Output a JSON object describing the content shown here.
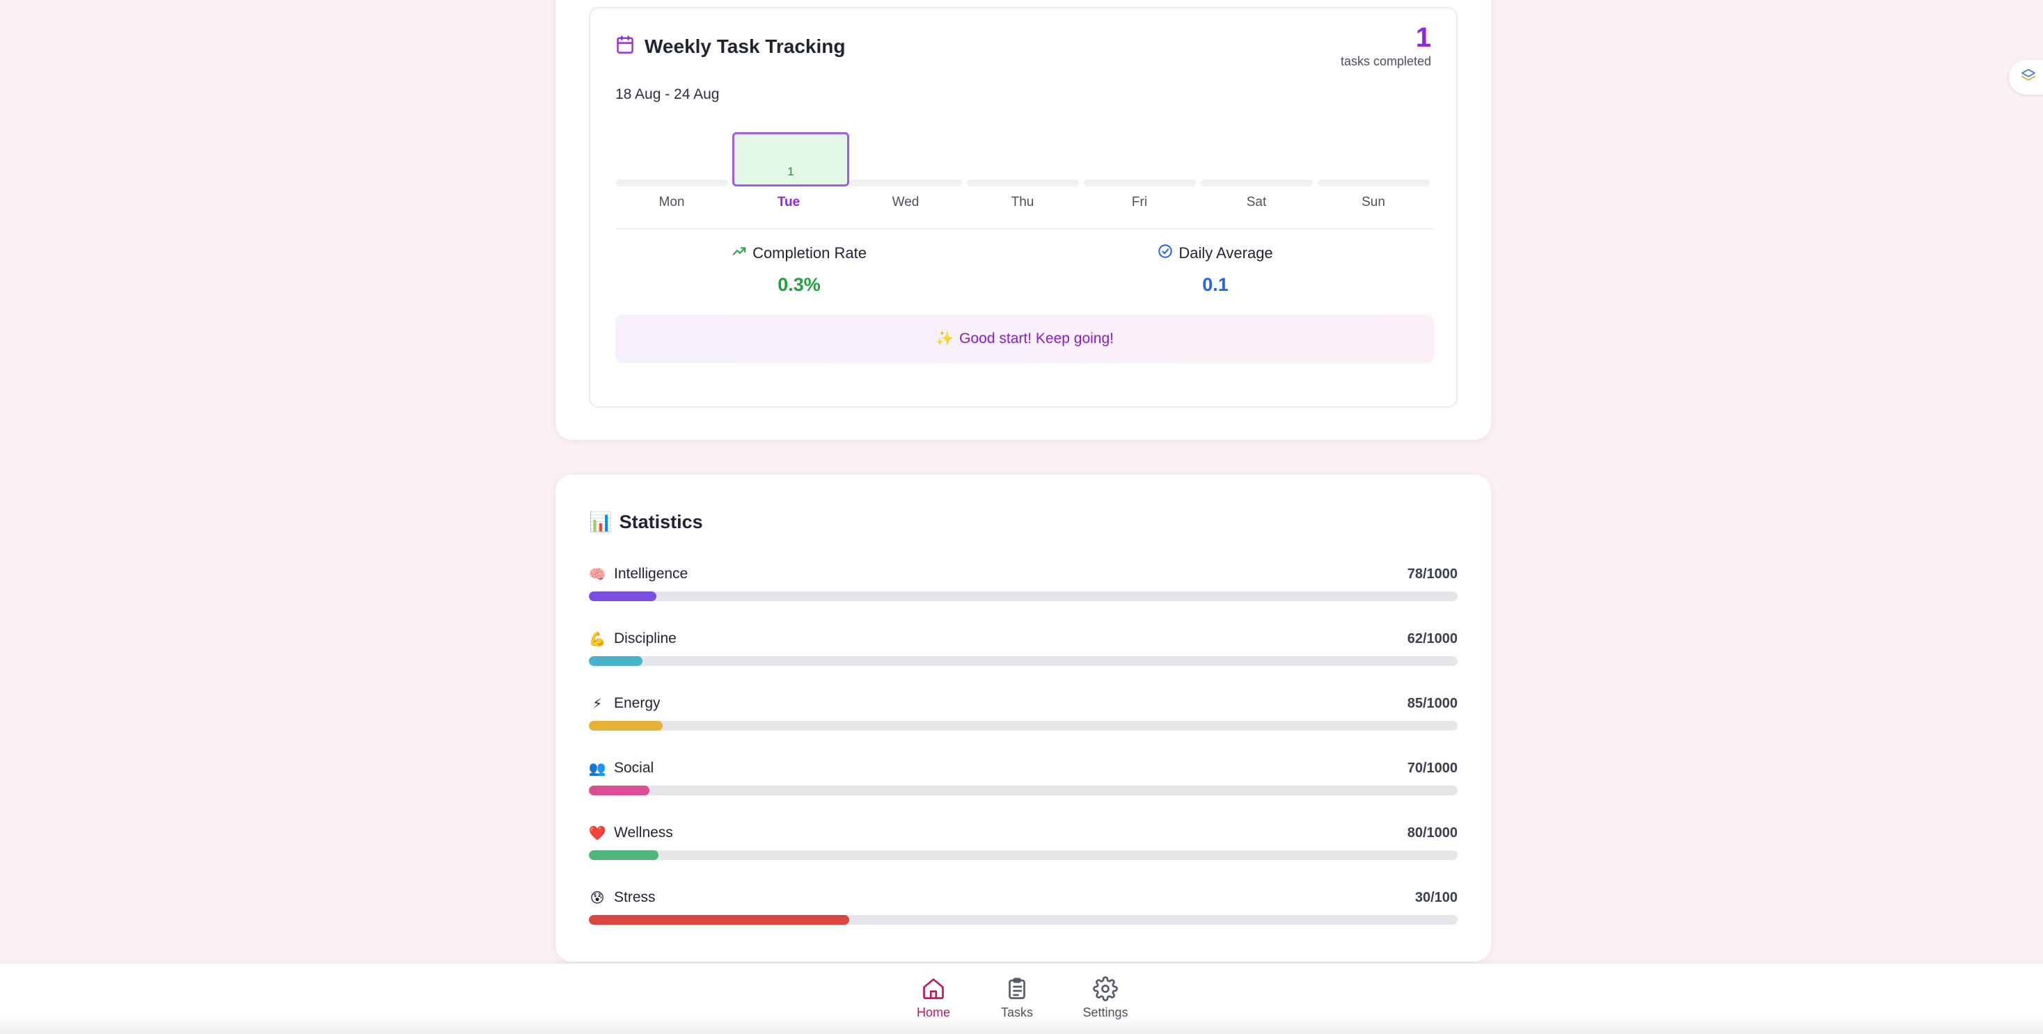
{
  "weekly": {
    "title": "Weekly Task Tracking",
    "date_range": "18 Aug - 24 Aug",
    "completed_count": "1",
    "completed_label": "tasks completed",
    "days": [
      {
        "label": "Mon",
        "count": 0,
        "active": false
      },
      {
        "label": "Tue",
        "count": 1,
        "active": true
      },
      {
        "label": "Wed",
        "count": 0,
        "active": false
      },
      {
        "label": "Thu",
        "count": 0,
        "active": false
      },
      {
        "label": "Fri",
        "count": 0,
        "active": false
      },
      {
        "label": "Sat",
        "count": 0,
        "active": false
      },
      {
        "label": "Sun",
        "count": 0,
        "active": false
      }
    ],
    "active_bar_value": "1",
    "completion_rate": {
      "label": "Completion Rate",
      "value": "0.3%"
    },
    "daily_average": {
      "label": "Daily Average",
      "value": "0.1"
    },
    "motivation": {
      "emoji": "✨",
      "text": "Good start! Keep going!"
    }
  },
  "statistics": {
    "emoji": "📊",
    "title": "Statistics",
    "items": [
      {
        "emoji": "🧠",
        "name": "Intelligence",
        "value": "78/1000",
        "fraction": 0.078,
        "color": "#7b4fe0"
      },
      {
        "emoji": "💪",
        "name": "Discipline",
        "value": "62/1000",
        "fraction": 0.062,
        "color": "#48b4cc"
      },
      {
        "emoji": "⚡",
        "name": "Energy",
        "value": "85/1000",
        "fraction": 0.085,
        "color": "#e5b236"
      },
      {
        "emoji": "👥",
        "name": "Social",
        "value": "70/1000",
        "fraction": 0.07,
        "color": "#dc4e94"
      },
      {
        "emoji": "❤️",
        "name": "Wellness",
        "value": "80/1000",
        "fraction": 0.08,
        "color": "#4fb57a"
      },
      {
        "emoji": "😰",
        "name": "Stress",
        "value": "30/100",
        "fraction": 0.3,
        "color": "#d9463f"
      }
    ]
  },
  "nav": {
    "home": "Home",
    "tasks": "Tasks",
    "settings": "Settings"
  },
  "icons": {
    "calendar": "calendar-icon",
    "trend": "trending-up-icon",
    "check_circle": "check-circle-icon",
    "home": "home-icon",
    "tasks": "clipboard-list-icon",
    "settings": "gear-icon",
    "side": "layers-icon"
  },
  "colors": {
    "accent_purple": "#9327e0",
    "home_active": "#c3185c",
    "completion_green": "#1fa23b",
    "average_blue": "#2563eb"
  }
}
